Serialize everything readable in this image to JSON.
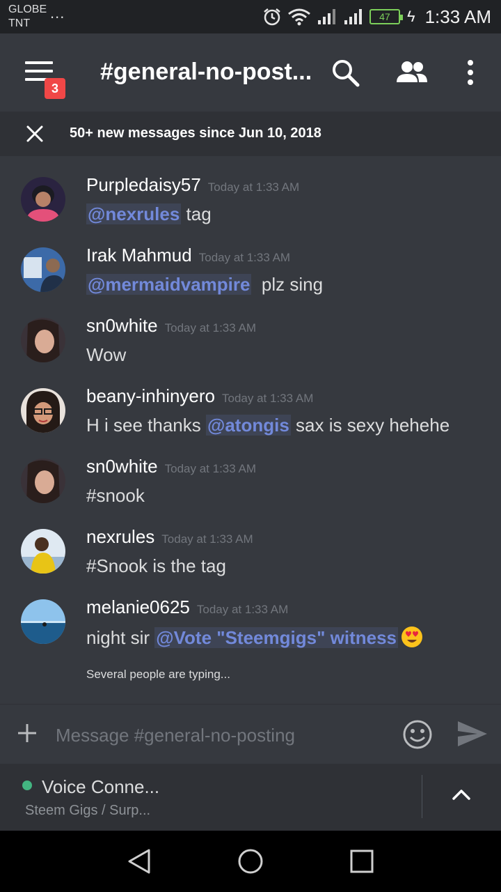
{
  "status_bar": {
    "carrier_line1": "GLOBE",
    "carrier_line2": "TNT",
    "more": "...",
    "battery": "47",
    "time": "1:33 AM"
  },
  "header": {
    "unread_count": "3",
    "channel_title": "#general-no-post..."
  },
  "banner": {
    "text": "50+ new messages since Jun 10, 2018"
  },
  "messages": [
    {
      "author": "Purpledaisy57",
      "timestamp": "Today at 1:33 AM",
      "mention": "@nexrules",
      "after": " tag"
    },
    {
      "author": "Irak Mahmud",
      "timestamp": "Today at 1:33 AM",
      "mention": "@mermaidvampire",
      "after": "  plz sing"
    },
    {
      "author": "sn0white",
      "timestamp": "Today at 1:33 AM",
      "text": "Wow"
    },
    {
      "author": "beany-inhinyero",
      "timestamp": "Today at 1:33 AM",
      "before": "H i see thanks ",
      "mention": "@atongis",
      "after": " sax is sexy hehehe"
    },
    {
      "author": "sn0white",
      "timestamp": "Today at 1:33 AM",
      "text": "#snook"
    },
    {
      "author": "nexrules",
      "timestamp": "Today at 1:33 AM",
      "text": "#Snook is the tag"
    },
    {
      "author": "melanie0625",
      "timestamp": "Today at 1:33 AM",
      "before": "night sir ",
      "mention": "@Vote \"Steemgigs\" witness",
      "emoji": "heart-eyes-emoji"
    }
  ],
  "typing_indicator": "Several people are typing...",
  "composer": {
    "placeholder": "Message #general-no-posting"
  },
  "voice": {
    "title": "Voice Conne...",
    "subtitle": "Steem Gigs / Surp...",
    "status_color": "#43b581"
  },
  "colors": {
    "background": "#36393f",
    "mention": "#7289da",
    "badge": "#f04747"
  }
}
